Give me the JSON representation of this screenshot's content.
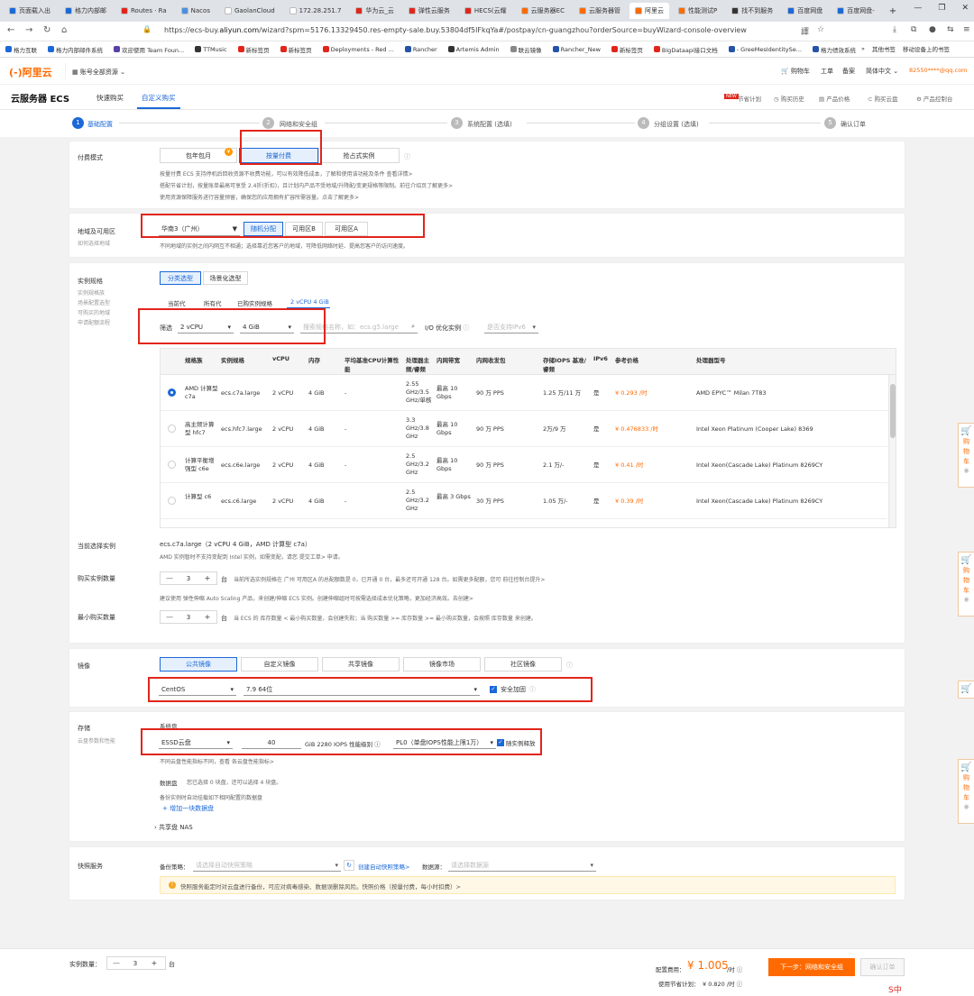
{
  "browser": {
    "tabs": [
      {
        "label": "页面载入出",
        "color": "#1b68d8"
      },
      {
        "label": "格力内部邮",
        "color": "#1b68d8"
      },
      {
        "label": "Routes · Ra",
        "color": "#e1251b"
      },
      {
        "label": "Nacos",
        "color": "#4a90e2"
      },
      {
        "label": "GaolanCloud",
        "color": "#ffffff"
      },
      {
        "label": "172.28.251.7",
        "color": "#ffffff"
      },
      {
        "label": "华为云_云",
        "color": "#e1251b"
      },
      {
        "label": "弹性云服务",
        "color": "#e1251b"
      },
      {
        "label": "HECS(云耀",
        "color": "#e1251b"
      },
      {
        "label": "云服务器EC",
        "color": "#ff6a00"
      },
      {
        "label": "云服务器管",
        "color": "#ff6a00"
      },
      {
        "label": "阿里云",
        "color": "#ff6a00",
        "active": true
      },
      {
        "label": "性能测试P",
        "color": "#ff6a00"
      },
      {
        "label": "找不到服务",
        "color": "#333333"
      },
      {
        "label": "百度网盘",
        "color": "#1b68d8"
      },
      {
        "label": "百度网盘-",
        "color": "#1b68d8"
      }
    ],
    "url_prefix": "https://ecs-buy.",
    "url_host": "aliyun.com",
    "url_rest": "/wizard?spm=5176.13329450.res-empty-sale.buy.53804df5lFkqYa#/postpay/cn-guangzhou?orderSource=buyWizard-console-overview",
    "bookmarks": [
      {
        "label": "格力互联",
        "color": "#1b68d8"
      },
      {
        "label": "格力内部邮件系统",
        "color": "#1b68d8"
      },
      {
        "label": "欢迎使用 Team Foun...",
        "color": "#5a3fa6"
      },
      {
        "label": "TTMusic",
        "color": "#333333"
      },
      {
        "label": "新标签页",
        "color": "#e1251b"
      },
      {
        "label": "新标签页",
        "color": "#e1251b"
      },
      {
        "label": "Deployments - Red ...",
        "color": "#e1251b"
      },
      {
        "label": "Rancher",
        "color": "#2453a8"
      },
      {
        "label": "Artemis Admin",
        "color": "#333333"
      },
      {
        "label": "联云镜像",
        "color": "#888888"
      },
      {
        "label": "Rancher_New",
        "color": "#2453a8"
      },
      {
        "label": "新标签页",
        "color": "#e1251b"
      },
      {
        "label": "BigDataapi接口文档",
        "color": "#e1251b"
      },
      {
        "label": "- GreeMesIdentitySe...",
        "color": "#2453a8"
      },
      {
        "label": "格力绩效系统",
        "color": "#2453a8"
      }
    ],
    "bookmarks_right": [
      "其他书签",
      "移动设备上的书签"
    ]
  },
  "aliyun": {
    "logo": "(-)阿里云",
    "account_menu": "账号全部资源",
    "header_right": [
      "购物车",
      "工单",
      "备案",
      "简体中文"
    ],
    "user": "82550****@qq.com"
  },
  "ecs": {
    "title": "云服务器 ECS",
    "tabs": [
      "快速购买",
      "自定义购买"
    ],
    "right_links": [
      "节省计划",
      "购买历史",
      "产品价格",
      "购买云盘",
      "产品控制台"
    ],
    "new_badge": "NEW"
  },
  "steps": [
    {
      "num": "1",
      "label": "基础配置",
      "hint": ""
    },
    {
      "num": "2",
      "label": "网络和安全组",
      "hint": ""
    },
    {
      "num": "3",
      "label": "系统配置",
      "hint": "(选填)"
    },
    {
      "num": "4",
      "label": "分组设置",
      "hint": "(选填)"
    },
    {
      "num": "5",
      "label": "确认订单",
      "hint": ""
    }
  ],
  "billing": {
    "label": "付费模式",
    "options": [
      "包年包月",
      "按量付费",
      "抢占式实例"
    ],
    "notes": [
      "按量付费 ECS 支持停机后回收资源不收费功能，可以有效降低成本，了解和使用该功能及条件 查看详情>",
      "搭配节省计划，按量账单最高可享受 2.4折(折扣)，且计划内产品不受地域/升降配/变更规格等限制。前往介绍页了解更多>",
      "使用资源保障服务进行容量预留，确保您的应用拥有扩容所需容量。点击了解更多>"
    ]
  },
  "region": {
    "label": "地域及可用区",
    "sub": "如何选择地域",
    "value": "华南3（广州）",
    "zones": [
      "随机分配",
      "可用区B",
      "可用区A"
    ],
    "note": "不同地域的实例之间内网互不相通；选择靠近您客户的地域，可降低网络时延、提高您客户的访问速度。"
  },
  "instance": {
    "label": "实例规格",
    "subs": [
      "实例规格族",
      "场景配置选型",
      "可购买的地域",
      "申请配额流程"
    ],
    "view_tabs": [
      "分类选型",
      "场景化选型"
    ],
    "gen_tabs": [
      "当前代",
      "所有代",
      "已购实例规格",
      "2 vCPU 4 GiB"
    ],
    "filter_label": "筛选",
    "vcpu": "2 vCPU",
    "mem": "4 GiB",
    "search_placeholder": "搜索规格名称，如：ecs.g5.large",
    "io_label": "I/O 优化实例",
    "ipv6_placeholder": "是否支持IPv6",
    "headers": [
      "规格族",
      "实例规格",
      "vCPU",
      "内存",
      "平均基准CPU计算性能",
      "处理器主频/睿频",
      "内网带宽",
      "内网收发包",
      "存储IOPS 基准/睿频",
      "IPv6",
      "参考价格",
      "处理器型号"
    ],
    "rows": [
      {
        "family": "AMD 计算型 c7a",
        "spec": "ecs.c7a.large",
        "vcpu": "2 vCPU",
        "mem": "4 GiB",
        "base": "-",
        "freq": "2.55 GHz/3.5 GHz/单核",
        "bw": "最高 10 Gbps",
        "pps": "90 万 PPS",
        "iops": "1.25 万/11 万",
        "ipv6": "是",
        "price": "¥ 0.293 /时",
        "cpu": "AMD EPYC™ Milan 7T83",
        "selected": true
      },
      {
        "family": "高主频计算型 hfc7",
        "spec": "ecs.hfc7.large",
        "vcpu": "2 vCPU",
        "mem": "4 GiB",
        "base": "-",
        "freq": "3.3 GHz/3.8 GHz",
        "bw": "最高 10 Gbps",
        "pps": "90 万 PPS",
        "iops": "2万/9 万",
        "ipv6": "是",
        "price": "¥ 0.476833 /时",
        "cpu": "Intel Xeon Platinum (Cooper Lake) 8369",
        "selected": false
      },
      {
        "family": "计算平衡增强型 c6e",
        "spec": "ecs.c6e.large",
        "vcpu": "2 vCPU",
        "mem": "4 GiB",
        "base": "-",
        "freq": "2.5 GHz/3.2 GHz",
        "bw": "最高 10 Gbps",
        "pps": "90 万 PPS",
        "iops": "2.1 万/-",
        "ipv6": "是",
        "price": "¥ 0.41 /时",
        "cpu": "Intel Xeon(Cascade Lake) Platinum 8269CY",
        "selected": false
      },
      {
        "family": "计算型 c6",
        "spec": "ecs.c6.large",
        "vcpu": "2 vCPU",
        "mem": "4 GiB",
        "base": "-",
        "freq": "2.5 GHz/3.2 GHz",
        "bw": "最高 3 Gbps",
        "pps": "30 万 PPS",
        "iops": "1.05 万/-",
        "ipv6": "是",
        "price": "¥ 0.39 /时",
        "cpu": "Intel Xeon(Cascade Lake) Platinum 8269CY",
        "selected": false
      }
    ]
  },
  "current": {
    "label": "当前选择实例",
    "value": "ecs.c7a.large（2 vCPU 4 GiB，AMD 计算型 c7a）",
    "note": "AMD 实例暂时不支持变配到 Intel 实例，如需变配，请您 提交工单> 申请。"
  },
  "quantity": {
    "label": "购买实例数量",
    "value": "3",
    "unit": "台",
    "note": "当前所选实例规格在 广州 可用区A 的总配额数是 0，已开通 0 台，最多还可开通 128 台。如需更多配额，您可 前往控制台提升>",
    "note2": "建议使用 弹性伸缩 Auto Scaling 产品，来创建/伸缩 ECS 实例。创建伸缩组时可按需选择成本优化策略，更加经济高效。去创建>"
  },
  "minqty": {
    "label": "最小购买数量",
    "value": "3",
    "unit": "台",
    "note": "当 ECS 的 库存数量 < 最小购买数量，会创建失败；当 购买数量 >= 库存数量 >= 最小购买数量，会按照 库存数量 来创建。"
  },
  "image": {
    "label": "镜像",
    "tabs": [
      "公共镜像",
      "自定义镜像",
      "共享镜像",
      "镜像市场",
      "社区镜像"
    ],
    "os": "CentOS",
    "version": "7.9 64位",
    "security": "安全加固"
  },
  "storage": {
    "label": "存储",
    "sub": "云盘参数和性能",
    "sys_label": "系统盘",
    "disk": "ESSD云盘",
    "size": "40",
    "size_unit": "GiB",
    "iops": "2280 IOPS",
    "perf_label": "性能级别",
    "perf": "PL0（单盘IOPS性能上限1万）",
    "release": "随实例释放",
    "note": "不同云盘性能指标不同，查看 各云盘性能指标>",
    "data_label": "数据盘",
    "data_note": "您已选择 0 块盘，还可以选择 4 块盘。",
    "data_note2": "备份实例时自动挂载如下相同配置的数据盘",
    "add_disk": "增加一块数据盘",
    "nas": "共享盘 NAS"
  },
  "snapshot": {
    "label": "快照服务",
    "policy_label": "备份策略：",
    "policy_placeholder": "请选择自动快照策略",
    "create_link": "创建自动快照策略>",
    "source_label": "数据源：",
    "source_placeholder": "请选择数据源",
    "tip": "快照服务能定时对云盘进行备份，可应对病毒感染、数据误删除风险。快照价格（按量付费，每小时扣费）>"
  },
  "side_cart": [
    "购",
    "物",
    "车"
  ],
  "footer": {
    "qty_label": "实例数量：",
    "qty": "3",
    "unit": "台",
    "fee_label": "配置费用：",
    "fee": "¥ 1.005",
    "fee_unit": "/时",
    "plan_label": "使用节省计划：",
    "plan": "¥ 0.820 /时",
    "next": "下一步：网络和安全组",
    "confirm": "确认订单"
  }
}
